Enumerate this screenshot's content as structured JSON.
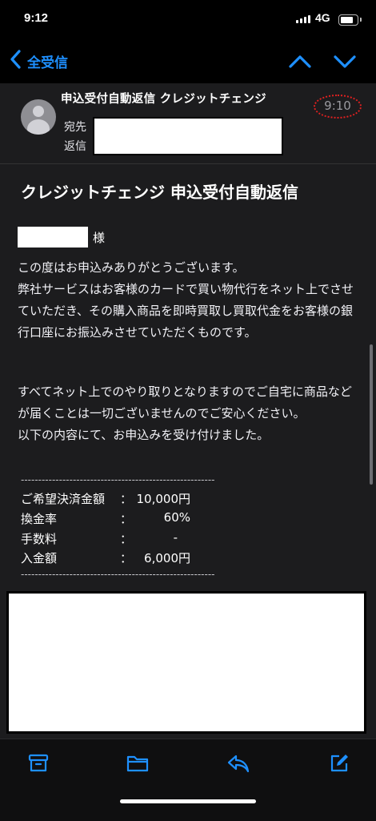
{
  "status_bar": {
    "time": "9:12",
    "network": "4G"
  },
  "nav": {
    "back_label": "全受信"
  },
  "header": {
    "subject": "申込受付自動返信 クレジットチェンジ",
    "time": "9:10",
    "to_label": "宛先",
    "reply_label": "返信"
  },
  "body": {
    "title": "クレジットチェンジ 申込受付自動返信",
    "honorific": "様",
    "paragraph1": "この度はお申込みありがとうございます。\n弊社サービスはお客様のカードで買い物代行をネット上でさせていただき、その購入商品を即時買取し買取代金をお客様の銀行口座にお振込みさせていただくものです。",
    "paragraph2": "すべてネット上でのやり取りとなりますのでご自宅に商品などが届くことは一切ございませんのでご安心ください。\n以下の内容にて、お申込みを受け付けました。",
    "divider": "--------------------------------------------------------",
    "separator": "：",
    "rows": [
      {
        "label": "ご希望決済金額",
        "value": "10,000円"
      },
      {
        "label": "換金率",
        "value": "60%"
      },
      {
        "label": "手数料",
        "value": "-"
      },
      {
        "label": "入金額",
        "value": "6,000円"
      }
    ]
  },
  "colors": {
    "accent": "#1e90ff",
    "background": "#1c1c1e",
    "highlight_circle": "#e02020"
  }
}
